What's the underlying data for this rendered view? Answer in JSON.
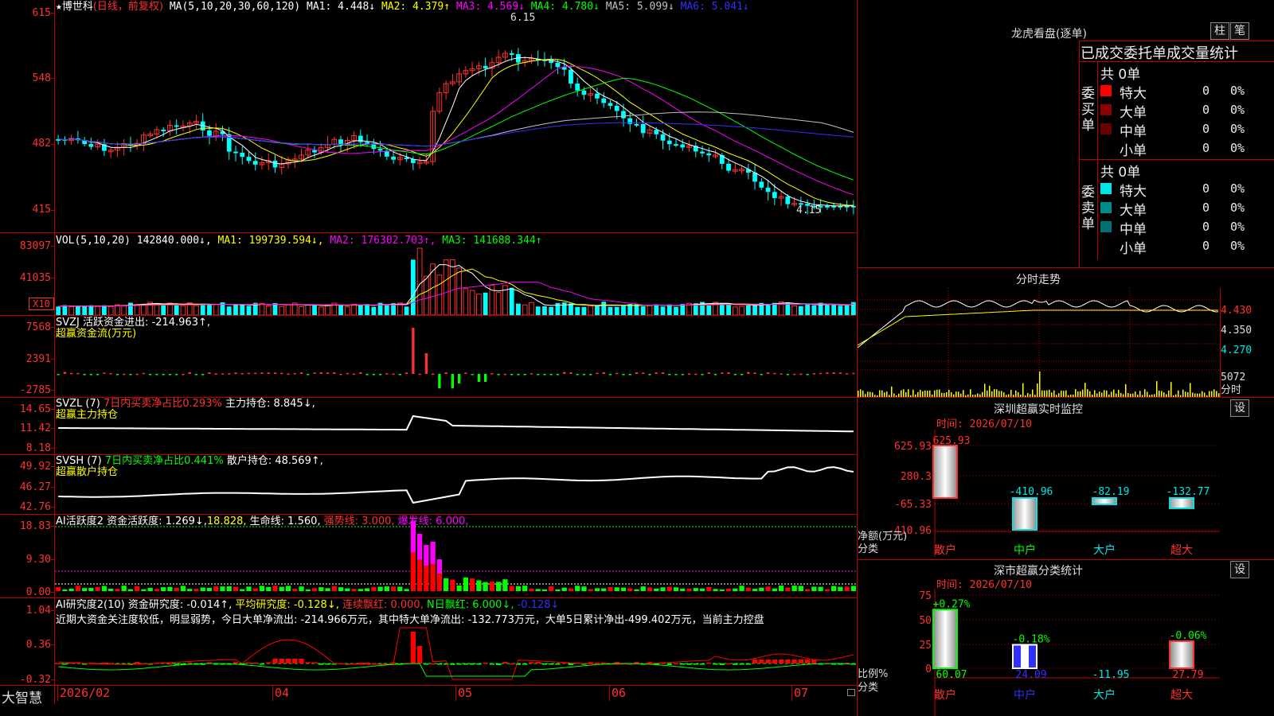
{
  "main": {
    "title_star": "★",
    "stock_name": "博世科",
    "period_label": "(日线，前复权)",
    "ma_header": "MA(5,10,20,30,60,120)",
    "ma_items": [
      {
        "label": "MA1: 4.448↓",
        "color": "#ffffff"
      },
      {
        "label": "MA2: 4.379↑",
        "color": "#ffff00"
      },
      {
        "label": "MA3: 4.569↓",
        "color": "#ff00ff"
      },
      {
        "label": "MA4: 4.780↓",
        "color": "#00ff00"
      },
      {
        "label": "MA5: 5.099↓",
        "color": "#c0c0c0"
      },
      {
        "label": "MA6: 5.041↓",
        "color": "#3030ff"
      }
    ],
    "y_labels": [
      "615",
      "548",
      "482",
      "415"
    ],
    "high_marker": "6.15",
    "low_marker": "4.15"
  },
  "vol": {
    "header": "VOL(5,10,20)",
    "value": "142840.000↓,",
    "ma1": "MA1: 199739.594↓,",
    "ma2": "MA2: 176302.703↑,",
    "ma3": "MA3: 141688.344↑",
    "y_labels": [
      "83097",
      "41035"
    ],
    "unit": "X10"
  },
  "svzj": {
    "header": "SVZJ  活跃资金进出: -214.963↑,",
    "sub": "超赢资金流(万元)",
    "y_labels": [
      "7568",
      "2391",
      "-2785"
    ]
  },
  "svzl": {
    "header": "SVZL (7) ",
    "ratio": "7日内买卖净占比0.293%",
    "hold": " 主力持仓: 8.845↓,",
    "sub": "超赢主力持仓",
    "y_labels": [
      "14.65",
      "11.42",
      "8.18"
    ]
  },
  "svsh": {
    "header": "SVSH (7) ",
    "ratio": "7日内买卖净占比0.441%",
    "hold": " 散户持仓: 48.569↑,",
    "sub": "超赢散户持仓",
    "y_labels": [
      "49.92",
      "46.27",
      "42.76"
    ]
  },
  "ai_active": {
    "header": "AI活跃度2 资金活跃度: 1.269↓,",
    "v2": "18.828,",
    "life": " 生命线: 1.560,",
    "strong": " 强势线: 3.000,",
    "burst": " 爆发线: 6.000,",
    "y_labels": [
      "18.83",
      "9.30",
      "0.00"
    ]
  },
  "ai_research": {
    "header": "AI研究度2(10) 资金研究度: -0.014↑,",
    "avg": " 平均研究度: -0.128↓,",
    "cont": " 连续飘红: 0.000,",
    "nday": " N日飘红: 6.000↓,",
    "last": " -0.128↓",
    "comment": "近期大资金关注度较低，明显弱势，今日大单净流出: -214.966万元，其中特大单净流出: -132.773万元，大单5日累计净出-499.402万元，当前主力控盘",
    "y_labels": [
      "1.04",
      "0.36",
      "-0.32"
    ]
  },
  "xaxis": {
    "brand": "大智慧",
    "labels": [
      "2026/02",
      "04",
      "05",
      "06",
      "07"
    ]
  },
  "right": {
    "dragon_title": "龙虎看盘(逐单)",
    "btn_bar": "柱",
    "btn_pen": "笔",
    "stats_title": "已成交委托单成交量统计",
    "buy_side_label": "委买单",
    "sell_side_label": "委卖单",
    "buy": {
      "total": "共 0单",
      "rows": [
        {
          "label": "特大",
          "count": "0",
          "pct": "0%",
          "color": "#ff0000"
        },
        {
          "label": "大单",
          "count": "0",
          "pct": "0%",
          "color": "#8b0000"
        },
        {
          "label": "中单",
          "count": "0",
          "pct": "0%",
          "color": "#6b0000"
        },
        {
          "label": "小单",
          "count": "0",
          "pct": "0%",
          "color": ""
        }
      ]
    },
    "sell": {
      "total": "共 0单",
      "rows": [
        {
          "label": "特大",
          "count": "0",
          "pct": "0%",
          "color": "#00e5e5"
        },
        {
          "label": "大单",
          "count": "0",
          "pct": "0%",
          "color": "#008b8b"
        },
        {
          "label": "中单",
          "count": "0",
          "pct": "0%",
          "color": "#007070"
        },
        {
          "label": "小单",
          "count": "0",
          "pct": "0%",
          "color": ""
        }
      ]
    },
    "intraday_title": "分时走势",
    "intraday_y": [
      "4.430",
      "4.350",
      "4.270"
    ],
    "intraday_vol": "5072",
    "intraday_vol_unit": "分时",
    "sz_title": "深圳超赢实时监控",
    "sz_settings": "设",
    "sz_time": "时间: 2026/07/10",
    "sz_y": [
      "625.93",
      "280.3",
      "-65.33",
      "-410.96"
    ],
    "sz_axis_label": "净额(万元)",
    "sz_axis_label2": "分类",
    "sz_bars": [
      {
        "cat": "散户",
        "value": "625.93"
      },
      {
        "cat": "中户",
        "value": "-410.96"
      },
      {
        "cat": "大户",
        "value": "-82.19"
      },
      {
        "cat": "超大",
        "value": "-132.77"
      }
    ],
    "cls_title": "深市超赢分类统计",
    "cls_settings": "设",
    "cls_time": "时间: 2026/07/10",
    "cls_y": [
      "75",
      "50",
      "25",
      "0"
    ],
    "cls_axis_label": "比例%",
    "cls_axis_label2": "分类",
    "cls_bars": [
      {
        "cat": "散户",
        "top": "+0.27%",
        "bottom": "60.07"
      },
      {
        "cat": "中户",
        "top": "-0.18%",
        "bottom": "24.09"
      },
      {
        "cat": "大户",
        "top": "",
        "bottom": "-11.95"
      },
      {
        "cat": "超大",
        "top": "-0.06%",
        "bottom": "27.79"
      }
    ]
  }
}
